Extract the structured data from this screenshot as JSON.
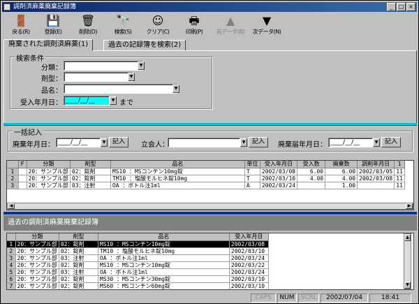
{
  "window": {
    "title": "調剤済麻薬廃棄記録簿"
  },
  "toolbar": [
    {
      "id": "back",
      "label": "戻る(R)",
      "icon": "door-icon",
      "glyph": "🚪"
    },
    {
      "id": "register",
      "label": "登録(E)",
      "icon": "floppy-icon",
      "glyph": "💾"
    },
    {
      "id": "delete",
      "label": "削除(D)",
      "icon": "trash-icon",
      "glyph": "🗑"
    },
    {
      "id": "search",
      "label": "検索(S)",
      "icon": "binoculars-icon",
      "glyph": "🔭"
    },
    {
      "id": "clear",
      "label": "クリア(C)",
      "icon": "smiley-icon",
      "glyph": "☺"
    },
    {
      "id": "print",
      "label": "印刷(P)",
      "icon": "printer-icon",
      "glyph": "🖶"
    },
    {
      "id": "prev",
      "label": "前データ(B)",
      "icon": "up-arrow-icon",
      "glyph": "▲",
      "disabled": true
    },
    {
      "id": "next",
      "label": "次データ(N)",
      "icon": "down-arrow-icon",
      "glyph": "▼"
    }
  ],
  "tabs": [
    "廃棄された調剤済麻薬(1)",
    "過去の記録簿を検索(2)"
  ],
  "search": {
    "group_label": "検索条件",
    "category_label": "分類：",
    "form_label": "剤型：",
    "name_label": "品名：",
    "date_label": "受入年月日：",
    "date_value": "____/__/__",
    "until": "まで"
  },
  "bulk": {
    "group_label": "一括記入",
    "disposal_label": "廃棄年月日：",
    "disposal_value": "____/__/__",
    "fill_label": "記入",
    "witness_label": "立会人：",
    "report_label": "廃棄届年月日：",
    "report_value": "____/__/__"
  },
  "grid1": {
    "headers": [
      "",
      "F",
      "分類",
      "剤型",
      "品名",
      "単位",
      "受入年月日",
      "受入数",
      "廃棄数",
      "調剤年月日",
      "1"
    ],
    "rows": [
      [
        "1",
        "",
        "20：サンプル部",
        "02：錠剤",
        "MS10  ：MSコンチン10mg錠",
        "T",
        "2002/03/08",
        "6.00",
        "6.00",
        "2002/03/05",
        "11"
      ],
      [
        "2",
        "",
        "20：サンプル部",
        "02：錠剤",
        "TM10  ：塩酸モルヒネ錠10mg",
        "T",
        "2002/03/10",
        "4.00",
        "4.00",
        "2002/03/08",
        "11"
      ],
      [
        "3",
        "",
        "20：サンプル部",
        "03：注射",
        "OA    ：ボトル注1ml",
        "A",
        "2002/03/24",
        "",
        "1.00",
        "",
        "11"
      ]
    ]
  },
  "section2": {
    "title": "過去の調剤済麻薬廃棄記録簿"
  },
  "grid2": {
    "headers": [
      "",
      "分類",
      "剤型",
      "品名",
      "受入年月日"
    ],
    "rows": [
      [
        "1",
        "20：サンプル部",
        "02：錠剤",
        "MS10  ：MSコンチン10mg錠",
        "2002/03/08"
      ],
      [
        "2",
        "20：サンプル部",
        "02：錠剤",
        "TM10  ：塩酸モルヒネ錠10mg",
        "2002/03/10"
      ],
      [
        "3",
        "20：サンプル部",
        "03：注射",
        "OA    ：ボトル注1ml",
        "2002/03/24"
      ],
      [
        "4",
        "20：サンプル部",
        "02：錠剤",
        "MS10  ：MSコンチン10mg錠",
        "2002/03/22"
      ],
      [
        "5",
        "20：サンプル部",
        "03：注射",
        "OA    ：ボトル注1ml",
        "2002/03/24"
      ],
      [
        "6",
        "20：サンプル部",
        "02：錠剤",
        "MS30  ：MSコンチン30mg錠",
        "2002/03/10"
      ],
      [
        "7",
        "20：サンプル部",
        "02：錠剤",
        "MS60  ：MSコンチン60mg錠",
        "2002/03/10"
      ]
    ]
  },
  "status": {
    "caps": "CAPS",
    "num": "NUM",
    "scrl": "SCRL",
    "date": "2002/07/04",
    "time": "18:41"
  }
}
